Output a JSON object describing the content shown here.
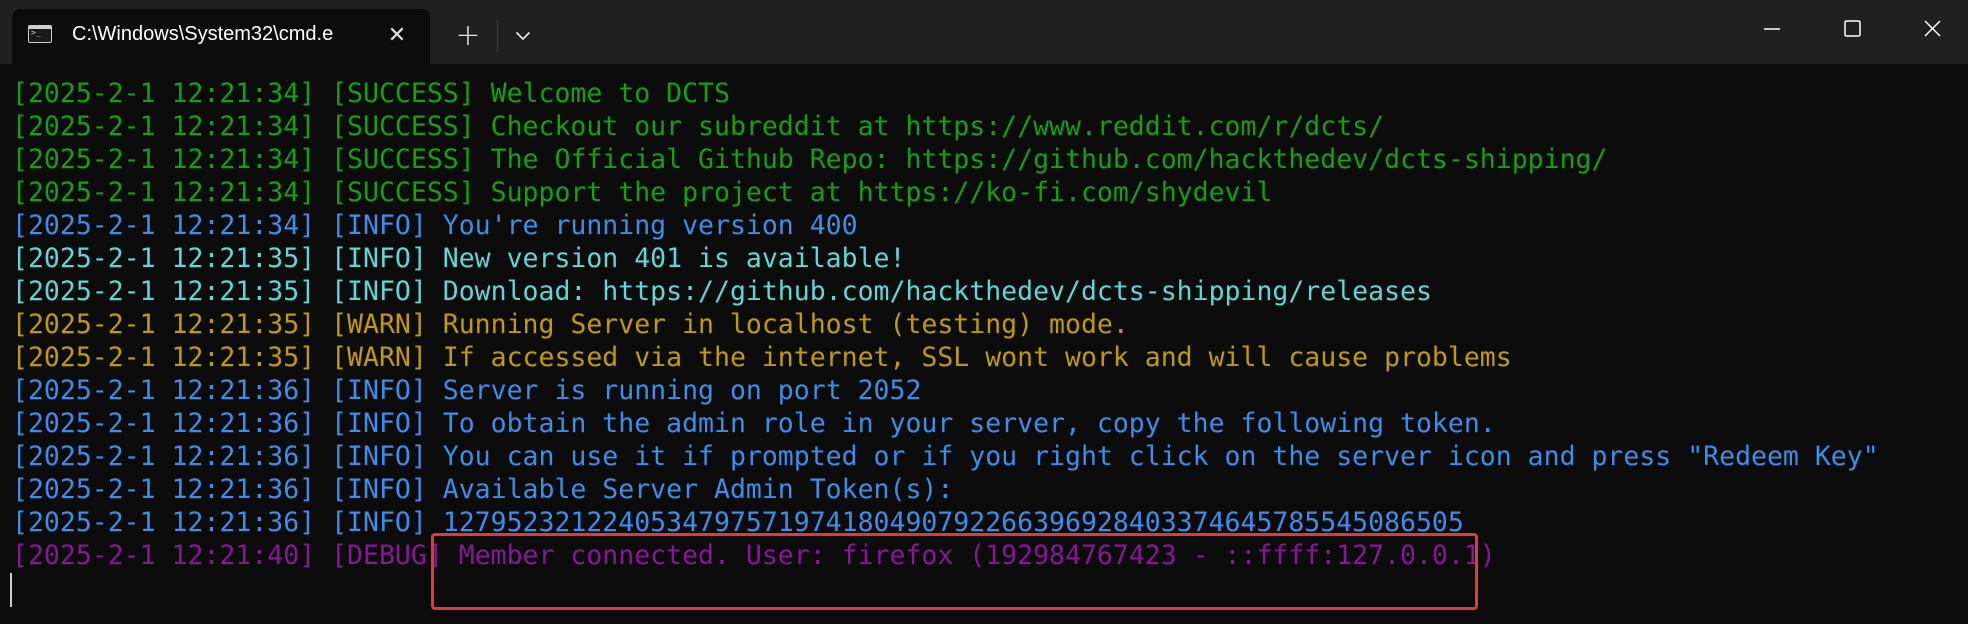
{
  "window": {
    "tab_title": "C:\\Windows\\System32\\cmd.e",
    "tab_icon": "terminal-icon",
    "close_tab_glyph": "✕",
    "new_tab_glyph": "+",
    "colors": {
      "titlebar": "#202020",
      "background": "#0c0c0c",
      "success": "#13a10e",
      "info": "#3b8eea",
      "info_cyan": "#61d6d6",
      "warn": "#c19c00",
      "debug": "#881798",
      "highlight": "#e5383b"
    }
  },
  "console": {
    "lines": [
      {
        "text": "[2025-2-1 12:21:34] [SUCCESS] Welcome to DCTS",
        "color": "#13a10e"
      },
      {
        "text": "[2025-2-1 12:21:34] [SUCCESS] Checkout our subreddit at https://www.reddit.com/r/dcts/",
        "color": "#13a10e"
      },
      {
        "text": "[2025-2-1 12:21:34] [SUCCESS] The Official Github Repo: https://github.com/hackthedev/dcts-shipping/",
        "color": "#13a10e"
      },
      {
        "text": "[2025-2-1 12:21:34] [SUCCESS] Support the project at https://ko-fi.com/shydevil",
        "color": "#13a10e"
      },
      {
        "text": "[2025-2-1 12:21:34] [INFO] You're running version 400",
        "color": "#3b8eea"
      },
      {
        "text": "[2025-2-1 12:21:35] [INFO] New version 401 is available!",
        "color": "#61d6d6"
      },
      {
        "text": "[2025-2-1 12:21:35] [INFO] Download: https://github.com/hackthedev/dcts-shipping/releases",
        "color": "#61d6d6"
      },
      {
        "text": "[2025-2-1 12:21:35] [WARN] Running Server in localhost (testing) mode.",
        "color": "#c19c00"
      },
      {
        "text": "[2025-2-1 12:21:35] [WARN] If accessed via the internet, SSL wont work and will cause problems",
        "color": "#c19c00"
      },
      {
        "text": "[2025-2-1 12:21:36] [INFO] Server is running on port 2052",
        "color": "#3b8eea"
      },
      {
        "text": "[2025-2-1 12:21:36] [INFO] To obtain the admin role in your server, copy the following token.",
        "color": "#3b8eea"
      },
      {
        "text": "[2025-2-1 12:21:36] [INFO] You can use it if prompted or if you right click on the server icon and press \"Redeem Key\"",
        "color": "#3b8eea"
      },
      {
        "text": "[2025-2-1 12:21:36] [INFO] Available Server Admin Token(s):",
        "color": "#3b8eea"
      },
      {
        "text": "[2025-2-1 12:21:36] [INFO] 127952321224053479757197418049079226639692840337464578554508650​5",
        "color": "#3b8eea"
      },
      {
        "text": "[2025-2-1 12:21:40] [DEBUG] Member connected. User: firefox (192984767423 - ::ffff:127.0.0.1)",
        "color": "#881798"
      }
    ]
  }
}
